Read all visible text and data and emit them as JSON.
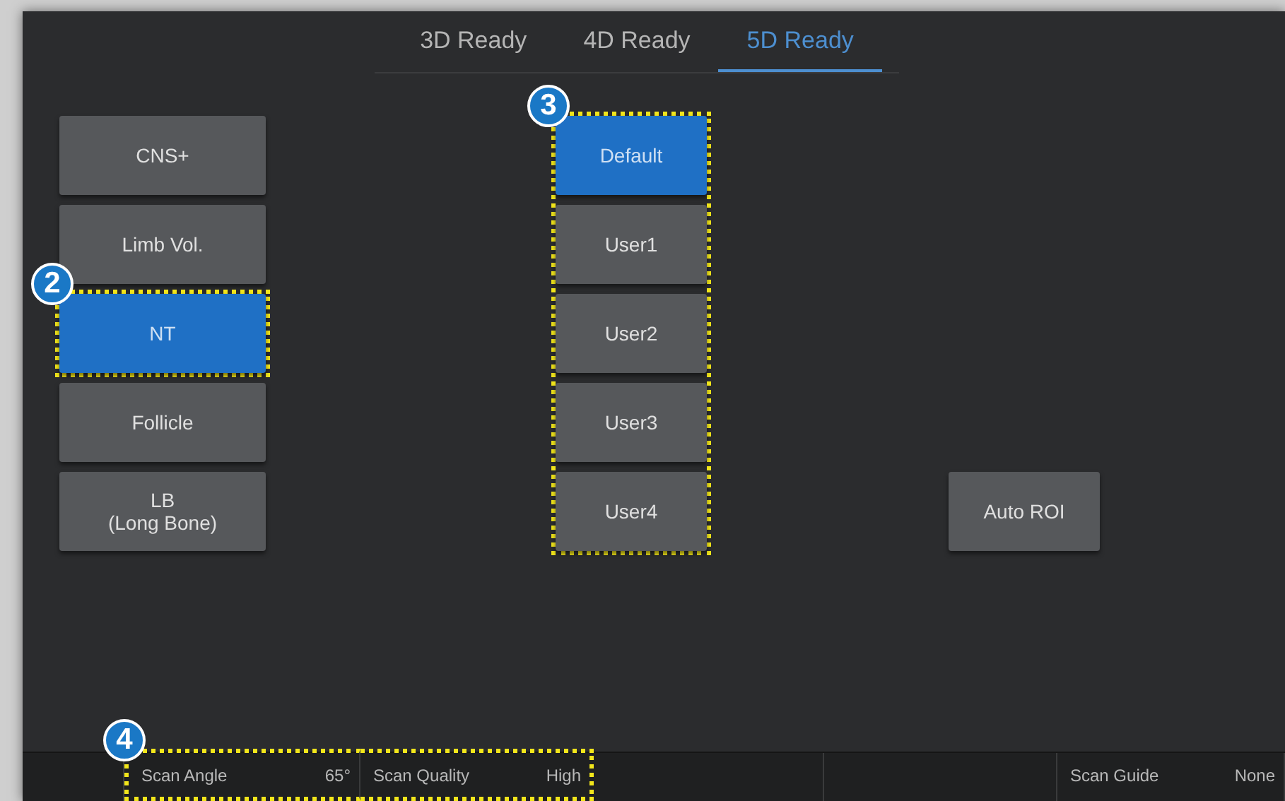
{
  "tabs": [
    {
      "label": "3D Ready",
      "selected": false
    },
    {
      "label": "4D Ready",
      "selected": false
    },
    {
      "label": "5D Ready",
      "selected": true
    }
  ],
  "presets": [
    {
      "label": "CNS+",
      "selected": false
    },
    {
      "label": "Limb Vol.",
      "selected": false
    },
    {
      "label": "NT",
      "selected": true,
      "callout": "2"
    },
    {
      "label": "Follicle",
      "selected": false
    },
    {
      "label": "LB\n(Long Bone)",
      "selected": false
    }
  ],
  "user_presets": {
    "callout": "3",
    "items": [
      {
        "label": "Default",
        "selected": true
      },
      {
        "label": "User1",
        "selected": false
      },
      {
        "label": "User2",
        "selected": false
      },
      {
        "label": "User3",
        "selected": false
      },
      {
        "label": "User4",
        "selected": false
      }
    ]
  },
  "auto_roi": {
    "label": "Auto ROI"
  },
  "status_bar": {
    "callout": "4",
    "cells": [
      {
        "highlighted": false
      },
      {
        "label": "Scan Angle",
        "value": "65°",
        "highlighted": true
      },
      {
        "label": "Scan Quality",
        "value": "High",
        "highlighted": true
      },
      {
        "highlighted": false
      },
      {
        "highlighted": false
      },
      {
        "label": "Scan Guide",
        "value": "None",
        "highlighted": false
      }
    ]
  }
}
